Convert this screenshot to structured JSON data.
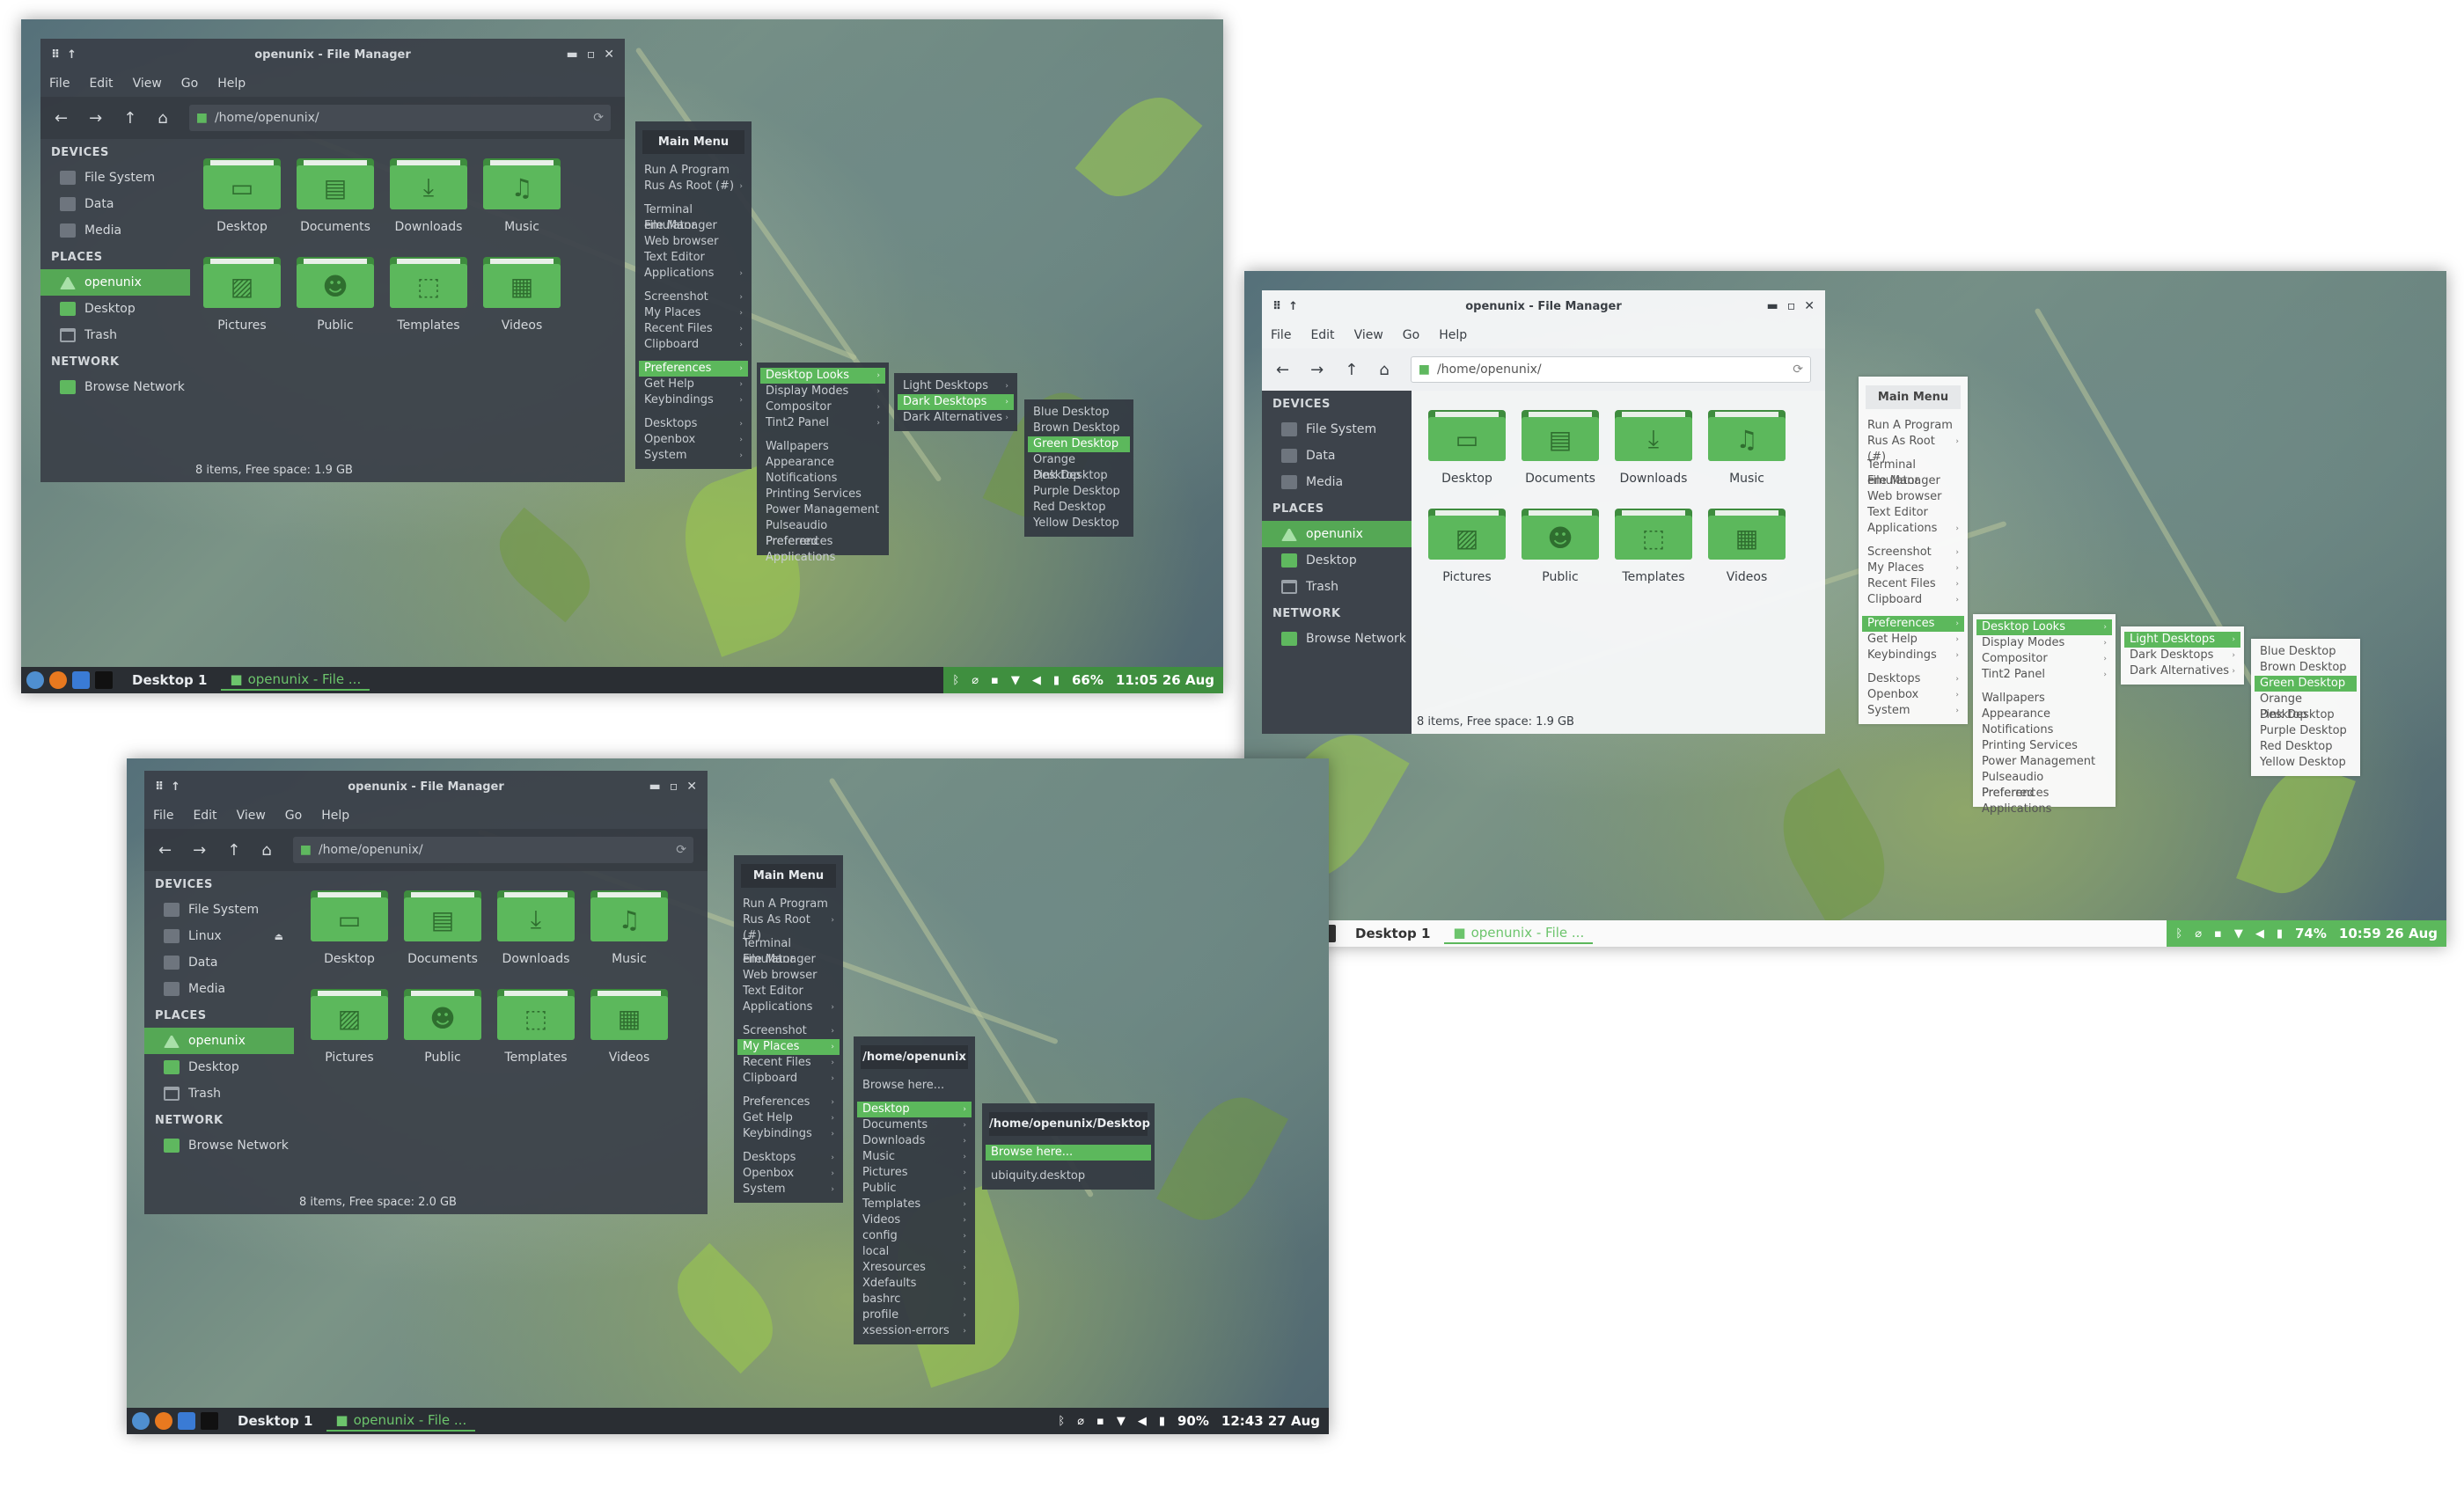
{
  "windows_title": "openunix - File Manager",
  "menubar": [
    "File",
    "Edit",
    "View",
    "Go",
    "Help"
  ],
  "location": "/home/openunix/",
  "sidebar": {
    "devices_header": "DEVICES",
    "devices_a": [
      "File System",
      "Data",
      "Media"
    ],
    "devices_c": [
      "File System",
      "Linux",
      "Data",
      "Media"
    ],
    "places_header": "PLACES",
    "places": [
      "openunix",
      "Desktop",
      "Trash"
    ],
    "network_header": "NETWORK",
    "network": [
      "Browse Network"
    ]
  },
  "folders": [
    "Desktop",
    "Documents",
    "Downloads",
    "Music",
    "Pictures",
    "Public",
    "Templates",
    "Videos"
  ],
  "status_a": "8 items, Free space: 1.9 GB",
  "status_b": "8 items, Free space: 1.9 GB",
  "status_c": "8 items, Free space: 2.0 GB",
  "main_menu": {
    "title": "Main Menu",
    "groups": [
      [
        "Run A Program",
        "Rus As Root (#)"
      ],
      [
        "Terminal emulator",
        "File Manager",
        "Web browser",
        "Text Editor",
        "Applications"
      ],
      [
        "Screenshot",
        "My Places",
        "Recent Files",
        "Clipboard"
      ],
      [
        "Preferences",
        "Get Help",
        "Keybindings"
      ],
      [
        "Desktops",
        "Openbox",
        "System"
      ]
    ]
  },
  "prefs_menu": {
    "group1": [
      "Desktop Looks",
      "Display Modes",
      "Compositor",
      "Tint2 Panel"
    ],
    "group2": [
      "Wallpapers",
      "Appearance",
      "Notifications",
      "Printing Services",
      "Power Management",
      "Pulseaudio Preferences",
      "Preferred Applications"
    ]
  },
  "looks_menu": [
    "Light Desktops",
    "Dark Desktops",
    "Dark Alternatives"
  ],
  "colors_menu": [
    "Blue Desktop",
    "Brown Desktop",
    "Green Desktop",
    "Orange Desktop",
    "Pink Desktop",
    "Purple Desktop",
    "Red Desktop",
    "Yellow Desktop"
  ],
  "places_menu": {
    "title": "/home/openunix",
    "browse": "Browse here...",
    "items": [
      "Desktop",
      "Documents",
      "Downloads",
      "Music",
      "Pictures",
      "Public",
      "Templates",
      "Videos",
      "config",
      "local",
      "Xresources",
      "Xdefaults",
      "bashrc",
      "profile",
      "xsession-errors"
    ]
  },
  "desktop_menu": {
    "title": "/home/openunix/Desktop",
    "browse": "Browse here...",
    "items": [
      "ubiquity.desktop"
    ]
  },
  "taskbar": {
    "workspace": "Desktop 1",
    "task": "openunix - File ...",
    "a": {
      "battery": "66%",
      "clock": "11:05 26 Aug"
    },
    "b": {
      "battery": "74%",
      "clock": "10:59 26 Aug"
    },
    "c": {
      "battery": "90%",
      "clock": "12:43 27 Aug"
    }
  },
  "icons": {
    "folders": [
      "monitor-icon",
      "document-icon",
      "download-icon",
      "music-note-icon",
      "image-icon",
      "people-icon",
      "template-icon",
      "film-icon"
    ]
  },
  "colors": {
    "accent": "#5cb85c",
    "accent_dark": "#3e8c3e",
    "panel_dark": "#3a4048"
  }
}
